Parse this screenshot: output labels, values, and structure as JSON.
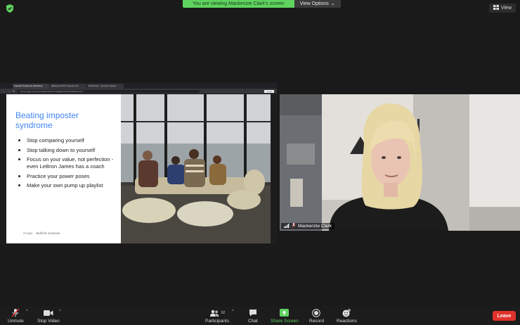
{
  "top": {
    "banner_text": "You are viewing Mackenzie Clark's screen",
    "view_options_label": "View Options",
    "view_label": "View"
  },
  "browser": {
    "tabs": [
      "Imposter Syndrome Workshop",
      "[Slides] A (OPT) Imposter Sy...",
      "Worksheet - Imposter Syndro..."
    ],
    "url": "docs.google.com/presentation/d/1eTUrlkQgIwGmSlh/edit#slide=id.g",
    "update_label": "Update"
  },
  "slide": {
    "title": "Beating imposter syndrome",
    "bullets": [
      "Stop comparing yourself",
      "Stop talking down to yourself",
      "Focus on your value, not perfection - even LeBron James has a coach",
      "Practice your power poses",
      "Make your own pump up playlist"
    ],
    "footer_brand": "Google",
    "footer_text": "Build for everyone"
  },
  "participant": {
    "name": "Mackenzie Clark"
  },
  "toolbar": {
    "unmute": "Unmute",
    "stop_video": "Stop Video",
    "participants": "Participants",
    "participants_count": "92",
    "chat": "Chat",
    "share_screen": "Share Screen",
    "record": "Record",
    "reactions": "Reactions",
    "leave": "Leave"
  },
  "colors": {
    "banner_green": "#5fd35f",
    "leave_red": "#e0322b",
    "slide_title_blue": "#4285f4"
  }
}
